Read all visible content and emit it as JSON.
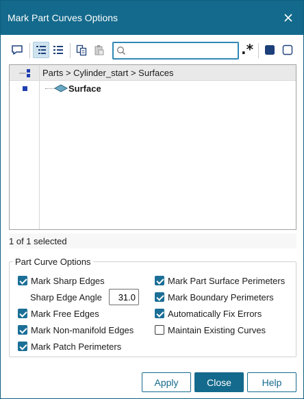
{
  "window": {
    "title": "Mark Part Curves Options"
  },
  "toolbar": {
    "search_value": "",
    "search_placeholder": "",
    "regex_label": ".*",
    "icons": [
      "comment-icon",
      "tree-view-icon",
      "list-view-icon",
      "copy-icon",
      "paste-icon",
      "search-icon",
      "select-all-icon",
      "select-none-icon"
    ]
  },
  "tree": {
    "breadcrumb": "Parts > Cylinder_start > Surfaces",
    "items": [
      {
        "label": "Surface",
        "icon": "surface-icon"
      }
    ]
  },
  "status": {
    "text": "1 of 1 selected"
  },
  "part_curve_options": {
    "title": "Part Curve Options",
    "mark_sharp_edges": {
      "label": "Mark Sharp Edges",
      "checked": true
    },
    "sharp_edge_angle": {
      "label": "Sharp Edge Angle",
      "value": "31.0"
    },
    "mark_free_edges": {
      "label": "Mark Free Edges",
      "checked": true
    },
    "mark_non_manifold_edges": {
      "label": "Mark Non-manifold Edges",
      "checked": true
    },
    "mark_patch_perimeters": {
      "label": "Mark Patch Perimeters",
      "checked": true
    },
    "mark_part_surface_perimeters": {
      "label": "Mark Part Surface Perimeters",
      "checked": true
    },
    "mark_boundary_perimeters": {
      "label": "Mark Boundary Perimeters",
      "checked": true
    },
    "automatically_fix_errors": {
      "label": "Automatically Fix Errors",
      "checked": true
    },
    "maintain_existing_curves": {
      "label": "Maintain Existing Curves",
      "checked": false
    }
  },
  "buttons": {
    "apply": "Apply",
    "close": "Close",
    "help": "Help"
  },
  "colors": {
    "titlebar": "#146a8c",
    "accent": "#1b6f97"
  }
}
